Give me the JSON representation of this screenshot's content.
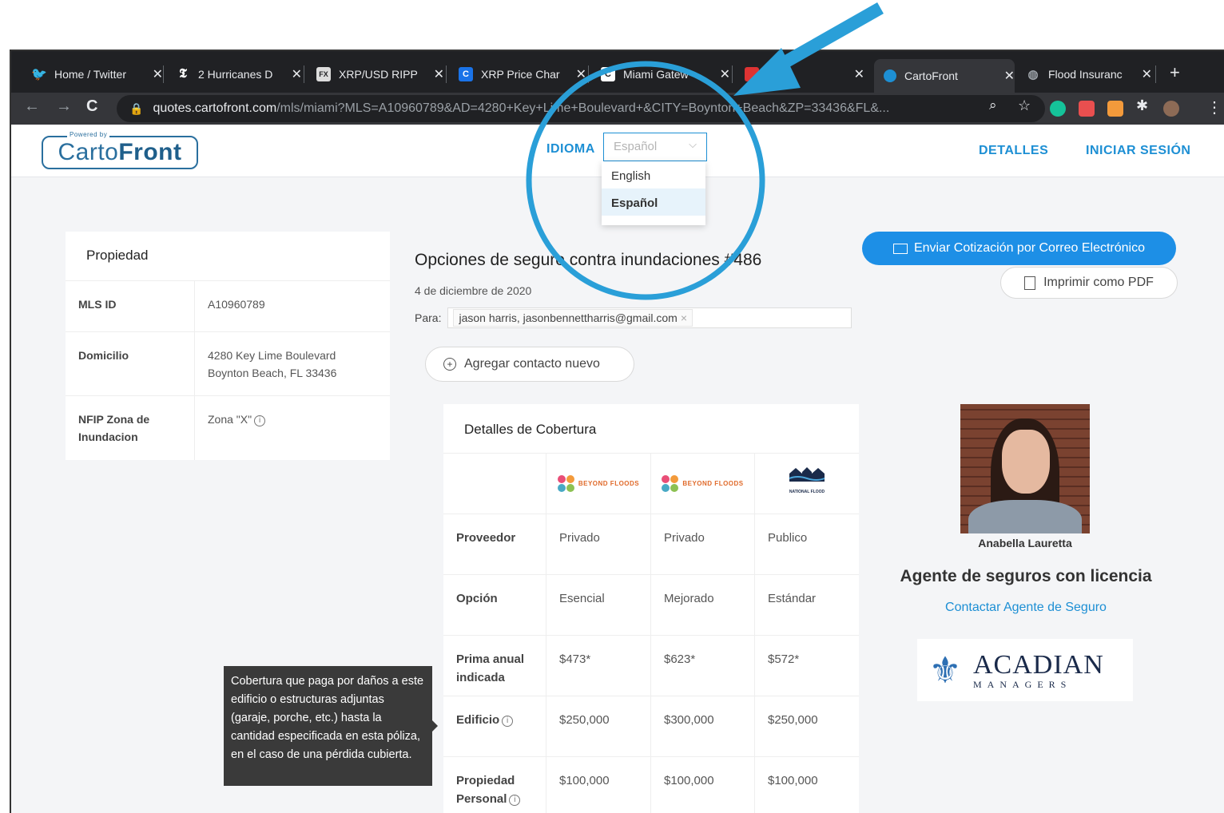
{
  "browser": {
    "tabs": [
      {
        "title": "Home / Twitter",
        "icon": "twitter-bird-icon"
      },
      {
        "title": "2 Hurricanes D",
        "icon": "nyt-icon"
      },
      {
        "title": "XRP/USD RIPP",
        "icon": "fx-icon"
      },
      {
        "title": "XRP Price Char",
        "icon": "coin-icon"
      },
      {
        "title": "Miami Gatew",
        "icon": "c-icon"
      },
      {
        "title": "",
        "icon": "red-icon"
      },
      {
        "title": "CartoFront",
        "icon": "cartofront-icon"
      },
      {
        "title": "Flood Insuranc",
        "icon": "globe-icon"
      }
    ],
    "url_host": "quotes.cartofront.com",
    "url_path": "/mls/miami?MLS=A10960789&AD=4280+Key+Lime+Boulevard+&CITY=Boynton+Beach&ZP=33436&FL&..."
  },
  "header": {
    "logo_powered": "Powered by",
    "logo_a": "Carto",
    "logo_b": "Front",
    "language_label": "IDIOMA",
    "language_selected": "Español",
    "language_options": [
      "English",
      "Español"
    ],
    "details_link": "DETALLES",
    "login_link": "INICIAR SESIÓN"
  },
  "property": {
    "title": "Propiedad",
    "rows": [
      {
        "key": "MLS ID",
        "value": "A10960789"
      },
      {
        "key": "Domicilio",
        "value_line1": "4280 Key Lime Boulevard",
        "value_line2": "Boynton Beach, FL 33436"
      },
      {
        "key": "NFIP Zona de Inundacion",
        "value": "Zona \"X\""
      }
    ]
  },
  "quote": {
    "title": "Opciones de seguro contra inundaciones #486",
    "date": "4 de diciembre de 2020",
    "to_label": "Para:",
    "recipient": "jason harris, jasonbennettharris@gmail.com",
    "add_contact": "Agregar contacto nuevo"
  },
  "coverage": {
    "title": "Detalles de Cobertura",
    "provider_logos": [
      "BEYOND FLOODS",
      "BEYOND FLOODS",
      "NATIONAL FLOOD"
    ],
    "rows": [
      {
        "label": "Proveedor",
        "values": [
          "Privado",
          "Privado",
          "Publico"
        ]
      },
      {
        "label": "Opción",
        "values": [
          "Esencial",
          "Mejorado",
          "Estándar"
        ]
      },
      {
        "label": "Prima anual indicada",
        "values": [
          "$473*",
          "$623*",
          "$572*"
        ]
      },
      {
        "label": "Edificio",
        "values": [
          "$250,000",
          "$300,000",
          "$250,000"
        ]
      },
      {
        "label": "Propiedad Personal",
        "values": [
          "$100,000",
          "$100,000",
          "$100,000"
        ]
      }
    ]
  },
  "tooltip": {
    "text": "Cobertura que paga por daños a este edificio o estructuras adjuntas (garaje, porche, etc.) hasta la cantidad especificada en esta póliza, en el caso de una pérdida cubierta."
  },
  "actions": {
    "email_button": "Enviar Cotización por Correo Electrónico",
    "pdf_button": "Imprimir como PDF"
  },
  "agent": {
    "name": "Anabella Lauretta",
    "title": "Agente de seguros con licencia",
    "contact_link": "Contactar Agente de Seguro",
    "company_line1": "ACADIAN",
    "company_line2": "MANAGERS"
  },
  "colors": {
    "accent": "#1d8fd4",
    "annotation": "#2a9fd8"
  }
}
